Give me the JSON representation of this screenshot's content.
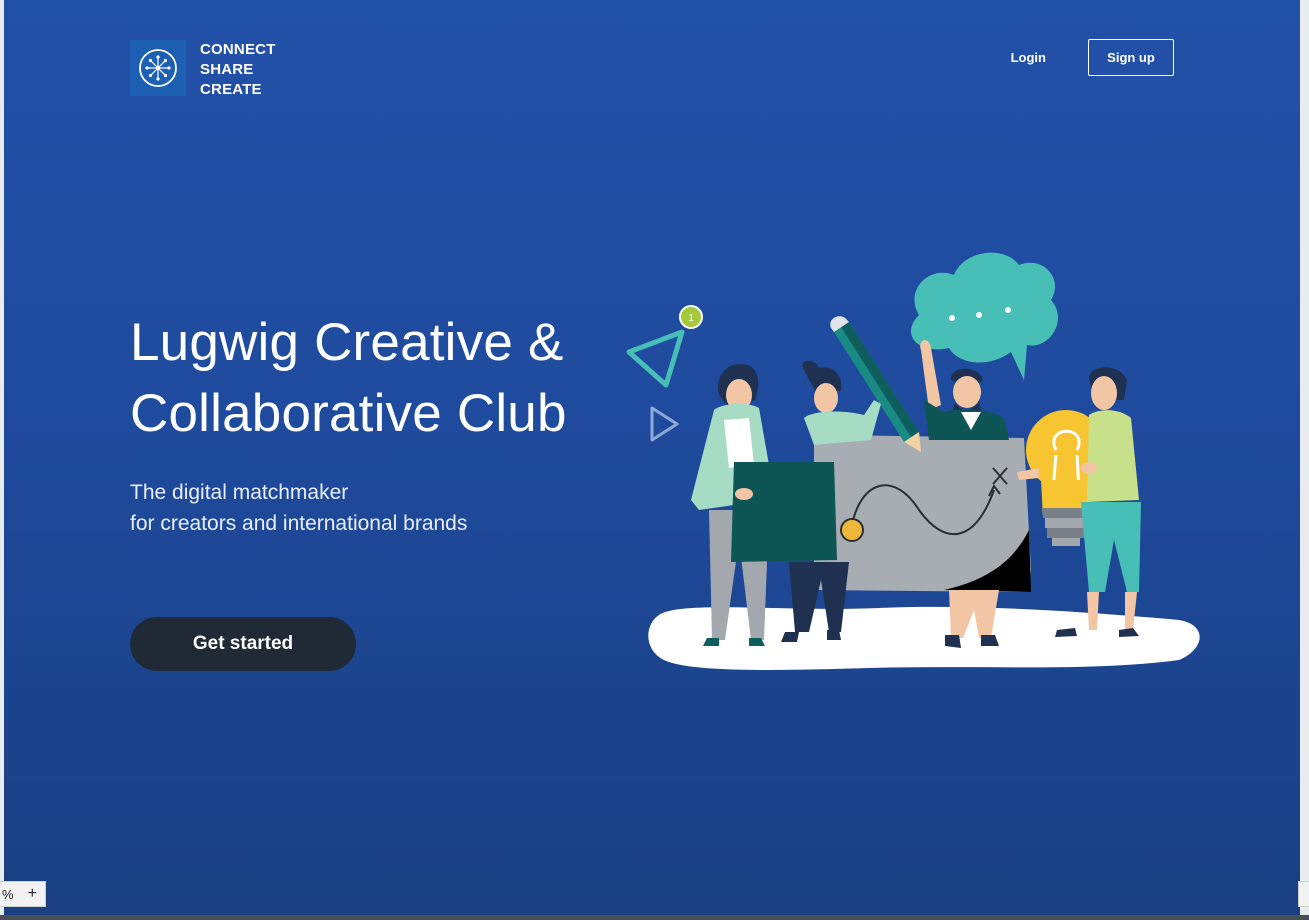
{
  "brand": {
    "lines": [
      "CONNECT",
      "SHARE",
      "CREATE"
    ],
    "icon": "network-hub-icon",
    "color": "#1d5fb3"
  },
  "nav": {
    "login_label": "Login",
    "signup_label": "Sign up"
  },
  "hero": {
    "title_lines": [
      "Lugwig Creative &",
      "Collaborative Club"
    ],
    "subtitle_lines": [
      "The digital matchmaker",
      "for creators and international brands"
    ],
    "cta_label": "Get started"
  },
  "illustration": {
    "notification_count": "1"
  },
  "zoom": {
    "value": "%",
    "plus": "+"
  },
  "colors": {
    "background_top": "#2251a8",
    "background_bottom": "#1a3f82",
    "cta": "#1f2a36",
    "teal": "#47bfb7",
    "yellow": "#f7c531"
  }
}
